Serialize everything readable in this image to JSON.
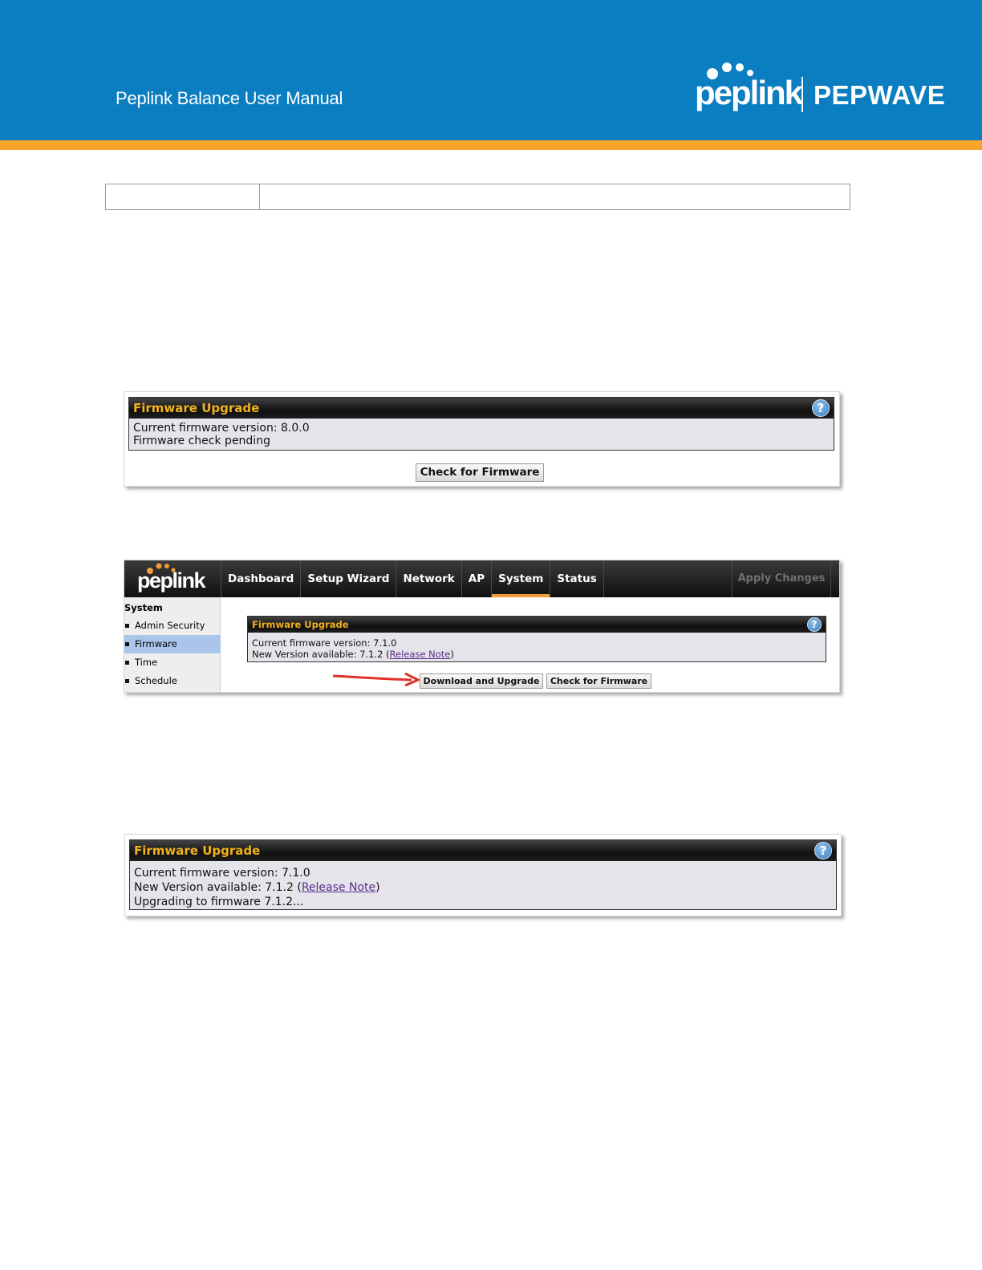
{
  "header": {
    "manual_title": "Peplink Balance User Manual",
    "brand_left": "peplink",
    "brand_right": "PEPWAVE"
  },
  "panel1": {
    "title": "Firmware Upgrade",
    "help": "?",
    "line1": "Current firmware version: 8.0.0",
    "line2": "Firmware check pending",
    "check_button": "Check for Firmware"
  },
  "panel2": {
    "logo": "peplink",
    "nav": [
      "Dashboard",
      "Setup Wizard",
      "Network",
      "AP",
      "System",
      "Status"
    ],
    "active_nav": "System",
    "apply": "Apply Changes",
    "sidebar_title": "System",
    "sidebar_items": [
      "Admin Security",
      "Firmware",
      "Time",
      "Schedule"
    ],
    "active_sidebar": "Firmware",
    "title": "Firmware Upgrade",
    "help": "?",
    "line1": "Current firmware version: 7.1.0",
    "line2_prefix": "New Version available: 7.1.2 (",
    "release_note": "Release Note",
    "line2_suffix": ")",
    "download_button": "Download and Upgrade",
    "check_button": "Check for Firmware"
  },
  "panel3": {
    "title": "Firmware Upgrade",
    "help": "?",
    "line1": "Current firmware version: 7.1.0",
    "line2_prefix": "New Version available: 7.1.2 (",
    "release_note": "Release Note",
    "line2_suffix": ")",
    "line3": "Upgrading to firmware 7.1.2..."
  },
  "colors": {
    "banner_blue": "#0b7dc1",
    "banner_orange": "#f6a52a",
    "title_gold": "#f2b21c",
    "active_tab_orange": "#f39c3c",
    "active_sidebar_blue": "#a9c6ea",
    "arrow_red": "#e0322b"
  }
}
